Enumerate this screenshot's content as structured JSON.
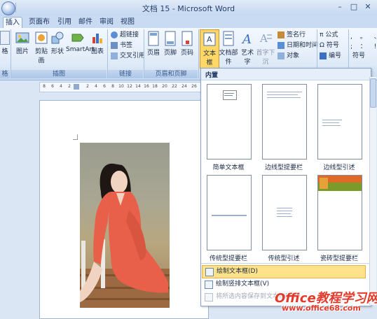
{
  "window": {
    "title": "文档 15 - Microsoft Word",
    "min": "–",
    "max": "□",
    "close": "✕"
  },
  "tabs": [
    {
      "label": "插入",
      "active": true
    },
    {
      "label": "页面布局",
      "active": false
    },
    {
      "label": "引用",
      "active": false
    },
    {
      "label": "邮件",
      "active": false
    },
    {
      "label": "审阅",
      "active": false
    },
    {
      "label": "视图",
      "active": false
    }
  ],
  "ribbon": {
    "groups": {
      "pages": "格",
      "illustrations": "插图",
      "links": "链接",
      "header_footer": "页眉和页脚"
    },
    "illustrations": [
      "图片",
      "剪贴画",
      "形状",
      "SmartArt",
      "图表"
    ],
    "links": [
      "超链接",
      "书签",
      "交叉引用"
    ],
    "header_footer": [
      "页眉",
      "页脚",
      "页码"
    ],
    "text": [
      "文本框",
      "文档部件",
      "艺术字",
      "首字下沉"
    ],
    "text_small": [
      "签名行",
      "日期和时间",
      "对象"
    ],
    "symbols": [
      "公式",
      "符号",
      "编号"
    ],
    "special": "符号",
    "cutoff_left": "格"
  },
  "ruler": {
    "ticks": [
      "8",
      "6",
      "4",
      "2",
      "",
      "2",
      "4",
      "6",
      "8",
      "10",
      "12",
      "14",
      "16",
      "18",
      "20",
      "22",
      "24",
      "26"
    ]
  },
  "gallery": {
    "header": "内置",
    "items": [
      {
        "label": "简单文本框"
      },
      {
        "label": "边线型提要栏"
      },
      {
        "label": "边线型引述"
      },
      {
        "label": "传统型提要栏"
      },
      {
        "label": "传统型引述"
      },
      {
        "label": "瓷砖型提要栏"
      }
    ],
    "menu": [
      {
        "label": "绘制文本框(D)",
        "highlight": true
      },
      {
        "label": "绘制竖排文本框(V)",
        "highlight": false
      },
      {
        "label": "将所选内容保存到文本框库(S)",
        "highlight": false,
        "disabled": true
      }
    ]
  },
  "watermark": {
    "text": "Office教程学习网",
    "url": "www.office68.com"
  },
  "colors": {
    "ribbon": "#dfeaf8",
    "highlight": "#ffe28a",
    "tile_orange": "#e06a25",
    "tile_green": "#7a9a2a",
    "dress": "#e8604a"
  }
}
